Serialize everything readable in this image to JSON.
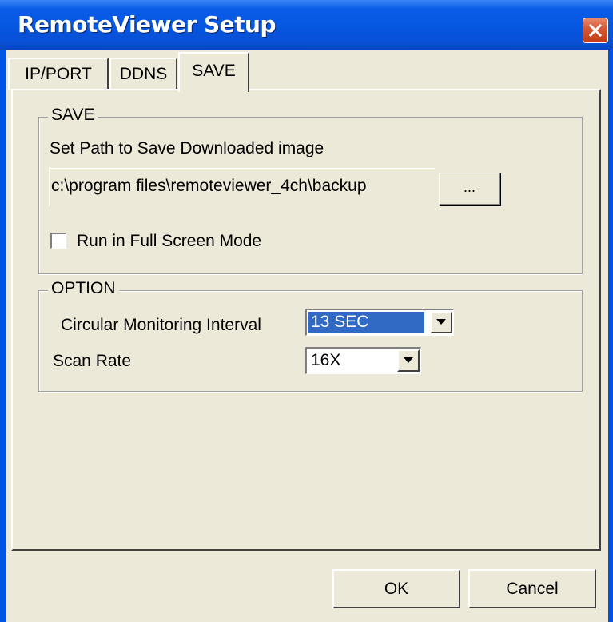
{
  "window": {
    "title": "RemoteViewer Setup"
  },
  "tabs": [
    {
      "label": "IP/PORT"
    },
    {
      "label": "DDNS"
    },
    {
      "label": "SAVE",
      "selected": true
    }
  ],
  "save_group": {
    "legend": "SAVE",
    "path_label": "Set Path to Save Downloaded image",
    "path_value": "c:\\program files\\remoteviewer_4ch\\backup",
    "browse_label": "...",
    "fullscreen_label": "Run in Full Screen Mode",
    "fullscreen_checked": false
  },
  "option_group": {
    "legend": "OPTION",
    "interval_label": "Circular Monitoring Interval",
    "interval_value": "13 SEC",
    "scan_rate_label": "Scan Rate",
    "scan_rate_value": "16X"
  },
  "buttons": {
    "ok": "OK",
    "cancel": "Cancel"
  },
  "colors": {
    "titlebar": "#0556e0",
    "face": "#ece9d8",
    "selection": "#316ac5",
    "close": "#c43c14"
  },
  "icons": {
    "close": "close-icon",
    "dropdown": "chevron-down-icon"
  }
}
